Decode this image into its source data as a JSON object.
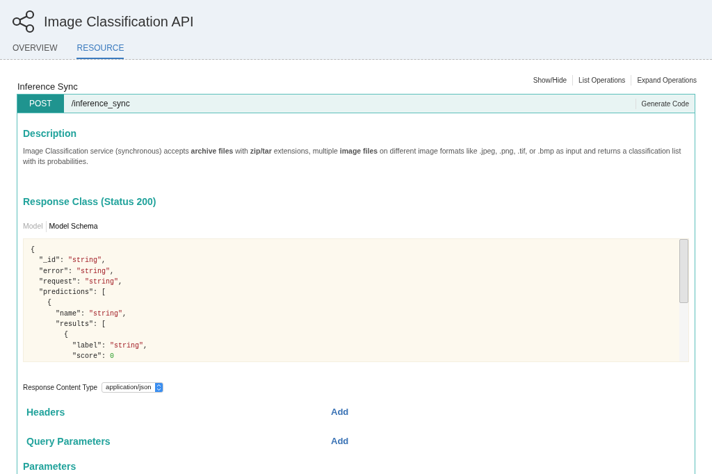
{
  "header": {
    "title": "Image Classification API"
  },
  "tabs": [
    {
      "label": "OVERVIEW",
      "selected": false
    },
    {
      "label": "RESOURCE",
      "selected": true
    }
  ],
  "resource": {
    "title": "Inference Sync",
    "actions": [
      "Show/Hide",
      "List Operations",
      "Expand Operations"
    ]
  },
  "operation": {
    "method": "POST",
    "path": "/inference_sync",
    "generate_code": "Generate Code",
    "description_heading": "Description",
    "description": "Image Classification service (synchronous) accepts **archive files** with **zip/tar** extensions, multiple **image files** on different image formats like .jpeg, .png, .tif, or .bmp as input and returns a classification list with its probabilities.",
    "response_heading": "Response Class (Status 200)",
    "model_tabs": [
      {
        "label": "Model",
        "selected": false
      },
      {
        "label": "Model Schema",
        "selected": true
      }
    ],
    "schema_lines": [
      [
        {
          "kind": "plain",
          "text": "{"
        }
      ],
      [
        {
          "kind": "plain",
          "text": "  \"_id\": "
        },
        {
          "kind": "string",
          "text": "\"string\""
        },
        {
          "kind": "plain",
          "text": ","
        }
      ],
      [
        {
          "kind": "plain",
          "text": "  \"error\": "
        },
        {
          "kind": "string",
          "text": "\"string\""
        },
        {
          "kind": "plain",
          "text": ","
        }
      ],
      [
        {
          "kind": "plain",
          "text": "  \"request\": "
        },
        {
          "kind": "string",
          "text": "\"string\""
        },
        {
          "kind": "plain",
          "text": ","
        }
      ],
      [
        {
          "kind": "plain",
          "text": "  \"predictions\": ["
        }
      ],
      [
        {
          "kind": "plain",
          "text": "    {"
        }
      ],
      [
        {
          "kind": "plain",
          "text": "      \"name\": "
        },
        {
          "kind": "string",
          "text": "\"string\""
        },
        {
          "kind": "plain",
          "text": ","
        }
      ],
      [
        {
          "kind": "plain",
          "text": "      \"results\": ["
        }
      ],
      [
        {
          "kind": "plain",
          "text": "        {"
        }
      ],
      [
        {
          "kind": "plain",
          "text": "          \"label\": "
        },
        {
          "kind": "string",
          "text": "\"string\""
        },
        {
          "kind": "plain",
          "text": ","
        }
      ],
      [
        {
          "kind": "plain",
          "text": "          \"score\": "
        },
        {
          "kind": "number",
          "text": "0"
        }
      ]
    ],
    "content_type_label": "Response Content Type",
    "content_type_value": "application/json",
    "sections": [
      {
        "title": "Headers",
        "action": "Add"
      },
      {
        "title": "Query Parameters",
        "action": "Add"
      },
      {
        "title": "Parameters"
      }
    ]
  }
}
